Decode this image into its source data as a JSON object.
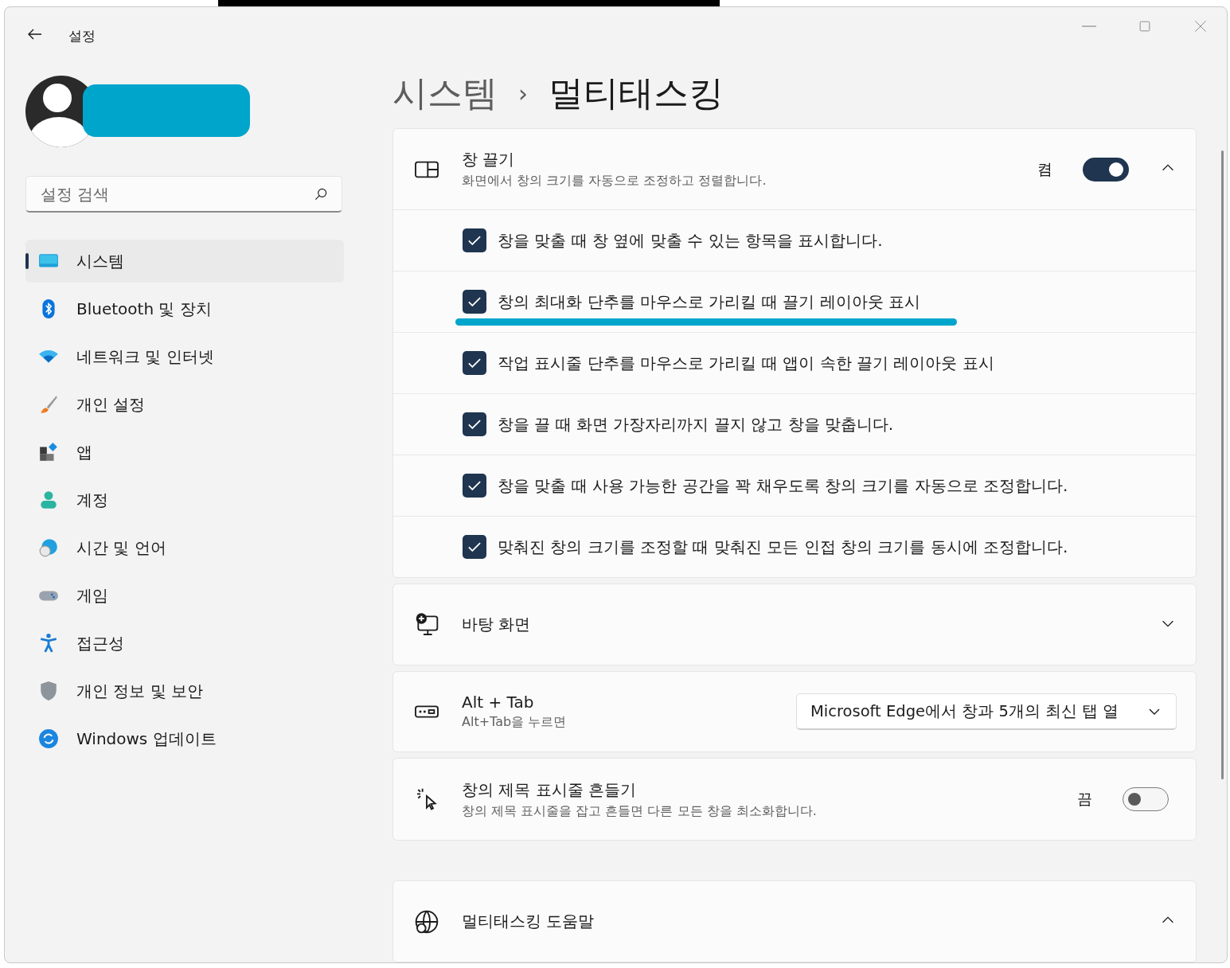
{
  "window": {
    "title": "설정"
  },
  "search": {
    "placeholder": "설정 검색"
  },
  "sidebar": {
    "items": [
      {
        "label": "시스템",
        "selected": true
      },
      {
        "label": "Bluetooth 및 장치",
        "selected": false
      },
      {
        "label": "네트워크 및 인터넷",
        "selected": false
      },
      {
        "label": "개인 설정",
        "selected": false
      },
      {
        "label": "앱",
        "selected": false
      },
      {
        "label": "계정",
        "selected": false
      },
      {
        "label": "시간 및 언어",
        "selected": false
      },
      {
        "label": "게임",
        "selected": false
      },
      {
        "label": "접근성",
        "selected": false
      },
      {
        "label": "개인 정보 및 보안",
        "selected": false
      },
      {
        "label": "Windows 업데이트",
        "selected": false
      }
    ]
  },
  "breadcrumb": {
    "parent": "시스템",
    "separator": "›",
    "current": "멀티태스킹"
  },
  "cards": [
    {
      "kind": "toggle",
      "title": "창 끌기",
      "subtitle": "화면에서 창의 크기를 자동으로 조정하고 정렬합니다.",
      "state_label": "켬",
      "on": true,
      "expanded": true,
      "options": [
        {
          "label": "창을 맞출 때 창 옆에 맞출 수 있는 항목을 표시합니다.",
          "checked": true,
          "highlighted": false
        },
        {
          "label": "창의 최대화 단추를 마우스로 가리킬 때 끌기 레이아웃 표시",
          "checked": true,
          "highlighted": true
        },
        {
          "label": "작업 표시줄 단추를 마우스로 가리킬 때 앱이 속한 끌기 레이아웃 표시",
          "checked": true,
          "highlighted": false
        },
        {
          "label": "창을 끌 때 화면 가장자리까지 끌지 않고 창을 맞춥니다.",
          "checked": true,
          "highlighted": false
        },
        {
          "label": "창을 맞출 때 사용 가능한 공간을 꽉 채우도록 창의 크기를 자동으로 조정합니다.",
          "checked": true,
          "highlighted": false
        },
        {
          "label": "맞춰진 창의 크기를 조정할 때 맞춰진 모든 인접 창의 크기를 동시에 조정합니다.",
          "checked": true,
          "highlighted": false
        }
      ]
    },
    {
      "kind": "expander",
      "title": "바탕 화면",
      "expanded": false
    },
    {
      "kind": "dropdown",
      "title": "Alt + Tab",
      "subtitle": "Alt+Tab을 누르면",
      "value": "Microsoft Edge에서 창과 5개의 최신 탭 열"
    },
    {
      "kind": "toggle",
      "title": "창의 제목 표시줄 흔들기",
      "subtitle": "창의 제목 표시줄을 잡고 흔들면 다른 모든 창을 최소화합니다.",
      "state_label": "끔",
      "on": false
    },
    {
      "kind": "expander",
      "title": "멀티태스킹 도움말",
      "expanded": true
    }
  ]
}
